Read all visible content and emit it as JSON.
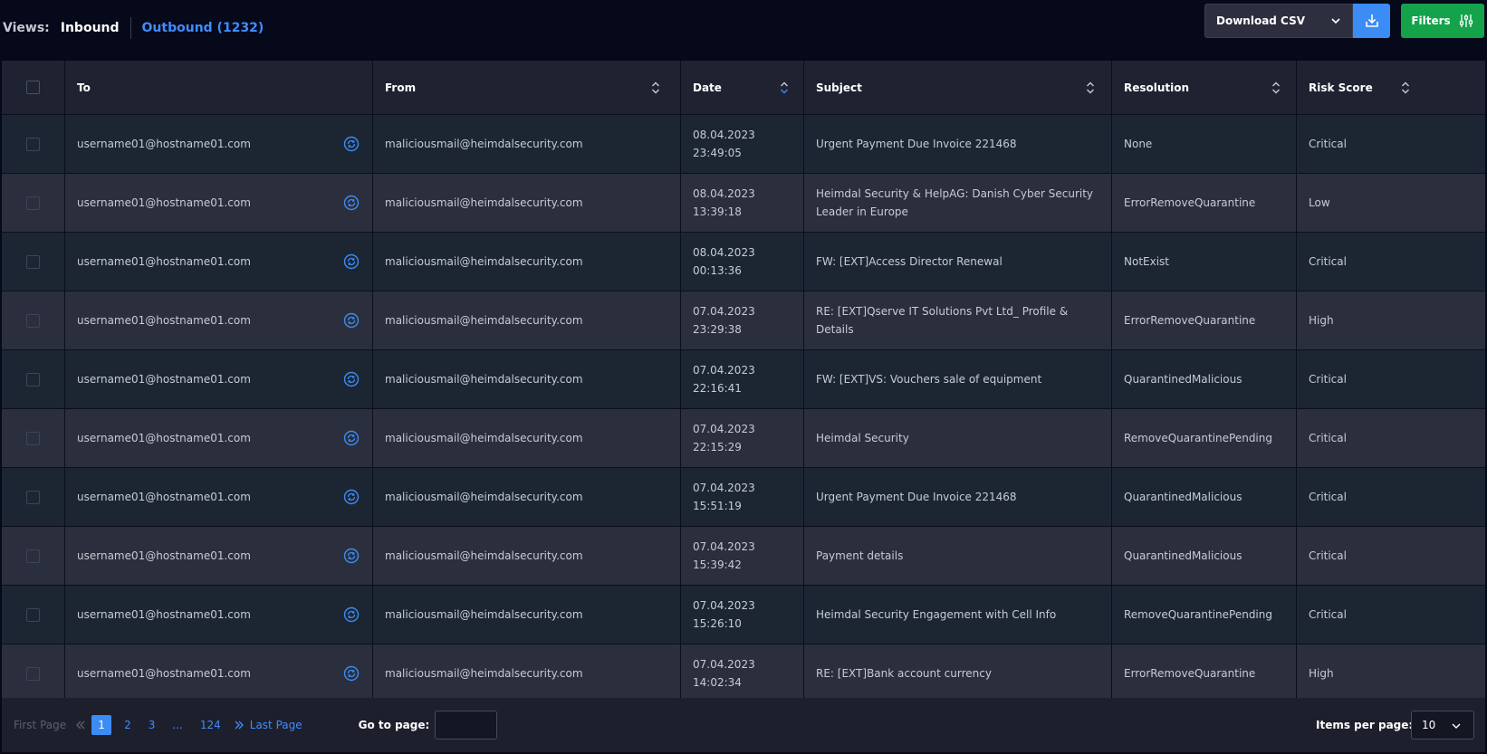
{
  "views": {
    "label": "Views:",
    "inbound": "Inbound",
    "outbound": "Outbound (1232)"
  },
  "toolbar": {
    "download_csv": "Download CSV",
    "filters": "Filters"
  },
  "columns": {
    "to": "To",
    "from": "From",
    "date": "Date",
    "subject": "Subject",
    "resolution": "Resolution",
    "risk": "Risk Score"
  },
  "rows": [
    {
      "to": "username01@hostname01.com",
      "from": "maliciousmail@heimdalsecurity.com",
      "date": "08.04.2023",
      "time": "23:49:05",
      "subject": "Urgent Payment Due Invoice 221468",
      "resolution": "None",
      "risk": "Critical"
    },
    {
      "to": "username01@hostname01.com",
      "from": "maliciousmail@heimdalsecurity.com",
      "date": "08.04.2023",
      "time": "13:39:18",
      "subject": "Heimdal Security & HelpAG: Danish Cyber Security Leader in Europe",
      "resolution": "ErrorRemoveQuarantine",
      "risk": "Low"
    },
    {
      "to": "username01@hostname01.com",
      "from": "maliciousmail@heimdalsecurity.com",
      "date": "08.04.2023",
      "time": "00:13:36",
      "subject": "FW: [EXT]Access Director Renewal",
      "resolution": "NotExist",
      "risk": "Critical"
    },
    {
      "to": "username01@hostname01.com",
      "from": "maliciousmail@heimdalsecurity.com",
      "date": "07.04.2023",
      "time": "23:29:38",
      "subject": "RE: [EXT]Qserve IT Solutions Pvt Ltd_ Profile & Details",
      "resolution": "ErrorRemoveQuarantine",
      "risk": "High"
    },
    {
      "to": "username01@hostname01.com",
      "from": "maliciousmail@heimdalsecurity.com",
      "date": "07.04.2023",
      "time": "22:16:41",
      "subject": "FW: [EXT]VS: Vouchers sale of equipment",
      "resolution": "QuarantinedMalicious",
      "risk": "Critical"
    },
    {
      "to": "username01@hostname01.com",
      "from": "maliciousmail@heimdalsecurity.com",
      "date": "07.04.2023",
      "time": "22:15:29",
      "subject": "Heimdal Security",
      "resolution": "RemoveQuarantinePending",
      "risk": "Critical"
    },
    {
      "to": "username01@hostname01.com",
      "from": "maliciousmail@heimdalsecurity.com",
      "date": "07.04.2023",
      "time": "15:51:19",
      "subject": "Urgent Payment Due Invoice 221468",
      "resolution": "QuarantinedMalicious",
      "risk": "Critical"
    },
    {
      "to": "username01@hostname01.com",
      "from": "maliciousmail@heimdalsecurity.com",
      "date": "07.04.2023",
      "time": "15:39:42",
      "subject": "Payment details",
      "resolution": "QuarantinedMalicious",
      "risk": "Critical"
    },
    {
      "to": "username01@hostname01.com",
      "from": "maliciousmail@heimdalsecurity.com",
      "date": "07.04.2023",
      "time": "15:26:10",
      "subject": "Heimdal Security Engagement with Cell Info",
      "resolution": "RemoveQuarantinePending",
      "risk": "Critical"
    },
    {
      "to": "username01@hostname01.com",
      "from": "maliciousmail@heimdalsecurity.com",
      "date": "07.04.2023",
      "time": "14:02:34",
      "subject": "RE: [EXT]Bank account currency",
      "resolution": "ErrorRemoveQuarantine",
      "risk": "High"
    }
  ],
  "pagination": {
    "first": "First Page",
    "pages": [
      "1",
      "2",
      "3",
      "...",
      "124"
    ],
    "last": "Last Page",
    "goto": "Go to page:",
    "items_per_page_label": "Items per page:",
    "items_per_page": "10"
  },
  "colors": {
    "accent": "#3b8cf5",
    "filters": "#14a24b"
  }
}
